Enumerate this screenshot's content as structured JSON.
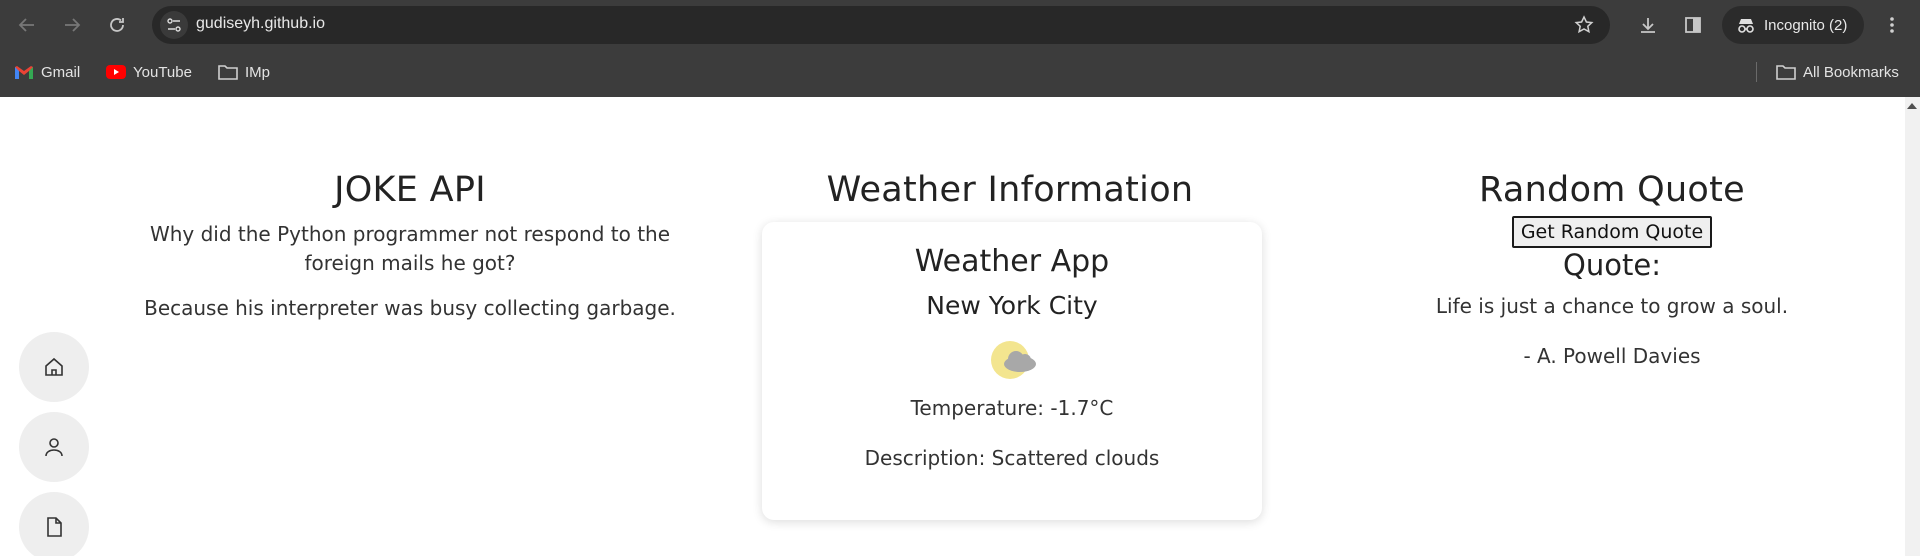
{
  "browser": {
    "url": "gudiseyh.github.io",
    "incognito_label": "Incognito (2)",
    "bookmarks": [
      {
        "label": "Gmail",
        "icon": "gmail-icon"
      },
      {
        "label": "YouTube",
        "icon": "youtube-icon"
      },
      {
        "label": "IMp",
        "icon": "folder-icon"
      }
    ],
    "all_bookmarks_label": "All Bookmarks"
  },
  "joke": {
    "title": "JOKE API",
    "setup": "Why did the Python programmer not respond to the foreign mails he got?",
    "punchline": "Because his interpreter was busy collecting garbage."
  },
  "weather": {
    "title": "Weather Information",
    "app_title": "Weather App",
    "city": "New York City",
    "icon": "scattered-clouds-icon",
    "temperature": "Temperature: -1.7°C",
    "description": "Description: Scattered clouds"
  },
  "quote": {
    "title": "Random Quote",
    "button_label": "Get Random Quote",
    "label": "Quote:",
    "text": "Life is just a chance to grow a soul.",
    "author": "- A. Powell Davies"
  },
  "sidebar": {
    "items": [
      {
        "name": "home",
        "icon": "home-icon"
      },
      {
        "name": "profile",
        "icon": "user-icon"
      },
      {
        "name": "document",
        "icon": "document-icon"
      }
    ]
  },
  "colors": {
    "chrome_bg": "#3c3c3c",
    "omnibox_bg": "#282828",
    "side_button_bg": "#eeeeee",
    "sun": "#f3e58f",
    "cloud": "#a8a8a8"
  }
}
